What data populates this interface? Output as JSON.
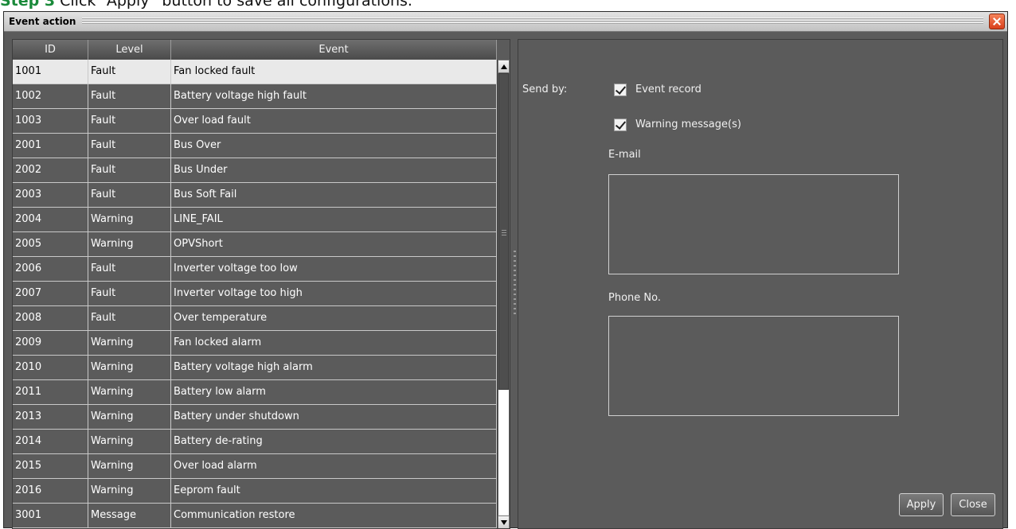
{
  "doc": {
    "step_prefix": "Step 3",
    "step_text": "Click “Apply” button to save all configurations."
  },
  "window": {
    "title": "Event action",
    "close_icon": "close-icon"
  },
  "table": {
    "columns": [
      "ID",
      "Level",
      "Event"
    ],
    "selected_index": 0,
    "rows": [
      {
        "id": "1001",
        "level": "Fault",
        "event": "Fan locked fault"
      },
      {
        "id": "1002",
        "level": "Fault",
        "event": "Battery voltage high fault"
      },
      {
        "id": "1003",
        "level": "Fault",
        "event": "Over load fault"
      },
      {
        "id": "2001",
        "level": "Fault",
        "event": "Bus Over"
      },
      {
        "id": "2002",
        "level": "Fault",
        "event": "Bus Under"
      },
      {
        "id": "2003",
        "level": "Fault",
        "event": "Bus Soft Fail"
      },
      {
        "id": "2004",
        "level": "Warning",
        "event": "LINE_FAIL"
      },
      {
        "id": "2005",
        "level": "Warning",
        "event": "OPVShort"
      },
      {
        "id": "2006",
        "level": "Fault",
        "event": "Inverter voltage too low"
      },
      {
        "id": "2007",
        "level": "Fault",
        "event": "Inverter voltage too high"
      },
      {
        "id": "2008",
        "level": "Fault",
        "event": "Over temperature"
      },
      {
        "id": "2009",
        "level": "Warning",
        "event": "Fan locked alarm"
      },
      {
        "id": "2010",
        "level": "Warning",
        "event": "Battery voltage high alarm"
      },
      {
        "id": "2011",
        "level": "Warning",
        "event": "Battery low alarm"
      },
      {
        "id": "2013",
        "level": "Warning",
        "event": "Battery under shutdown"
      },
      {
        "id": "2014",
        "level": "Warning",
        "event": "Battery de-rating"
      },
      {
        "id": "2015",
        "level": "Warning",
        "event": "Over load alarm"
      },
      {
        "id": "2016",
        "level": "Warning",
        "event": "Eeprom fault"
      },
      {
        "id": "3001",
        "level": "Message",
        "event": "Communication restore"
      }
    ]
  },
  "form": {
    "send_by_label": "Send by:",
    "event_record": {
      "label": "Event record",
      "checked": true
    },
    "warning_messages": {
      "label": "Warning message(s)",
      "checked": true
    },
    "email_label": "E-mail",
    "email_value": "",
    "phone_label": "Phone No.",
    "phone_value": "",
    "apply_label": "Apply",
    "close_label": "Close"
  }
}
